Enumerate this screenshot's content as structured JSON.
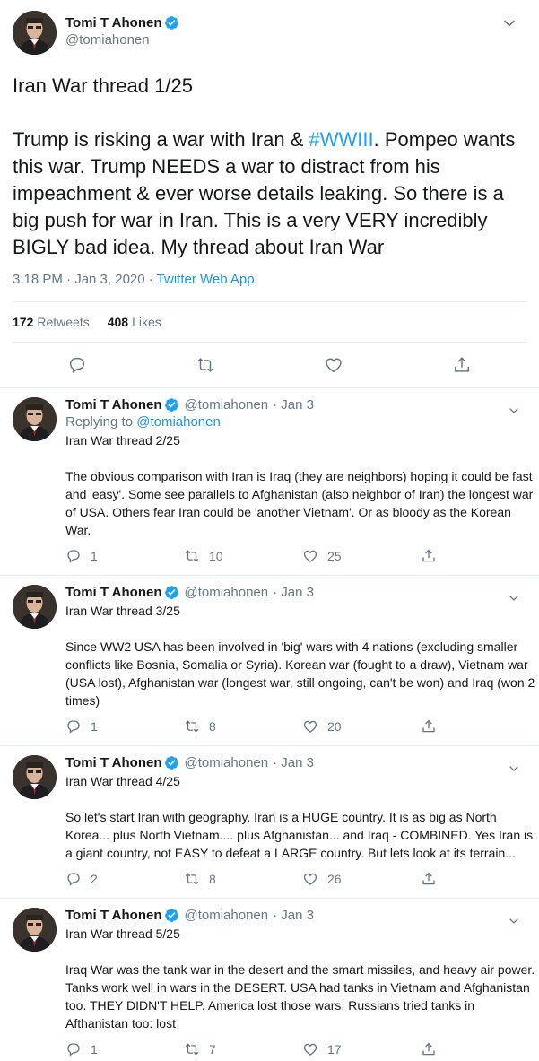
{
  "main_tweet": {
    "author": {
      "name": "Tomi T Ahonen",
      "handle": "@tomiahonen"
    },
    "text_before_tag": "Iran War thread 1/25\n\nTrump is risking a war with Iran & ",
    "hashtag": "#WWIII",
    "text_after_tag": ". Pompeo wants this war. Trump NEEDS a war to distract from his impeachment & ever worse details leaking. So there is a big push for war in Iran. This is a very VERY incredibly BIGLY bad idea. My thread about Iran War",
    "timestamp": "3:18 PM · Jan 3, 2020 · ",
    "source": "Twitter Web App",
    "retweets_count": "172",
    "retweets_label": "Retweets",
    "likes_count": "408",
    "likes_label": "Likes"
  },
  "replies": [
    {
      "name": "Tomi T Ahonen",
      "handle": "@tomiahonen",
      "time": "· Jan 3",
      "replying_prefix": "Replying to ",
      "replying_to": "@tomiahonen",
      "text": "Iran War thread 2/25\n\nThe obvious comparison with Iran is Iraq (they are neighbors) hoping it could be fast and 'easy'. Some see parallels to Afghanistan (also neighbor of Iran) the longest war of USA. Others fear Iran could be 'another Vietnam'. Or as bloody as the Korean War.",
      "replies": "1",
      "retweets": "10",
      "likes": "25"
    },
    {
      "name": "Tomi T Ahonen",
      "handle": "@tomiahonen",
      "time": "· Jan 3",
      "text": "Iran War thread 3/25\n\nSince WW2 USA has been involved in 'big' wars with 4 nations (excluding smaller conflicts like Bosnia, Somalia or Syria). Korean war (fought to a draw), Vietnam war (USA lost), Afghanistan war (longest war, still ongoing, can't be won) and Iraq (won 2 times)",
      "replies": "1",
      "retweets": "8",
      "likes": "20"
    },
    {
      "name": "Tomi T Ahonen",
      "handle": "@tomiahonen",
      "time": "· Jan 3",
      "text": "Iran War thread 4/25\n\nSo let's start Iran with geography. Iran is a HUGE country. It is as big as North Korea... plus North Vietnam.... plus Afghanistan... and Iraq - COMBINED. Yes Iran is a giant country, not EASY to defeat a LARGE country. But lets look at its terrain...",
      "replies": "2",
      "retweets": "8",
      "likes": "26"
    },
    {
      "name": "Tomi T Ahonen",
      "handle": "@tomiahonen",
      "time": "· Jan 3",
      "text": "Iran War thread 5/25\n\nIraq War was the tank war in the desert and the smart missiles, and heavy air power. Tanks work well in wars in the DESERT. USA had tanks in Vietnam and Afghanistan too. THEY DIDN'T HELP. America lost those wars. Russians tried tanks in Afthanistan too: lost",
      "replies": "1",
      "retweets": "7",
      "likes": "17"
    }
  ],
  "colors": {
    "accent": "#1da1f2",
    "muted": "#657786",
    "text": "#14171a",
    "border": "#e6ecf0"
  }
}
